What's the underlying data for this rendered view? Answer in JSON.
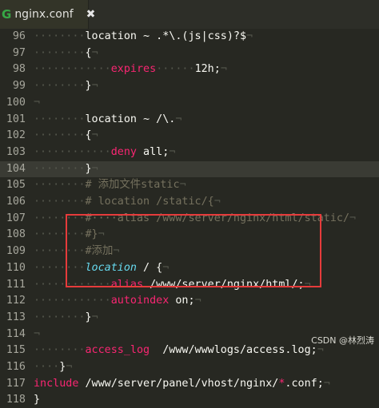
{
  "tab": {
    "title": "nginx.conf",
    "icon": "nginx-icon",
    "close": "✖",
    "badge": "G"
  },
  "lines": [
    {
      "num": "96",
      "segments": [
        {
          "t": "········",
          "c": "ws"
        },
        {
          "t": "location ~ .*\\.(js|css)?$",
          "c": "code"
        },
        {
          "t": "¬",
          "c": "ws"
        }
      ]
    },
    {
      "num": "97",
      "segments": [
        {
          "t": "········",
          "c": "ws"
        },
        {
          "t": "{",
          "c": "code"
        },
        {
          "t": "¬",
          "c": "ws"
        }
      ]
    },
    {
      "num": "98",
      "segments": [
        {
          "t": "········",
          "c": "ws"
        },
        {
          "t": "····",
          "c": "ws"
        },
        {
          "t": "expires",
          "c": "val"
        },
        {
          "t": "······",
          "c": "ws"
        },
        {
          "t": "12h;",
          "c": "code"
        },
        {
          "t": "¬",
          "c": "ws"
        }
      ]
    },
    {
      "num": "99",
      "segments": [
        {
          "t": "········",
          "c": "ws"
        },
        {
          "t": "}",
          "c": "code"
        },
        {
          "t": "¬",
          "c": "ws"
        }
      ]
    },
    {
      "num": "100",
      "segments": [
        {
          "t": "¬",
          "c": "ws"
        }
      ]
    },
    {
      "num": "101",
      "segments": [
        {
          "t": "········",
          "c": "ws"
        },
        {
          "t": "location ~ /\\.",
          "c": "code"
        },
        {
          "t": "¬",
          "c": "ws"
        }
      ]
    },
    {
      "num": "102",
      "segments": [
        {
          "t": "········",
          "c": "ws"
        },
        {
          "t": "{",
          "c": "code"
        },
        {
          "t": "¬",
          "c": "ws"
        }
      ]
    },
    {
      "num": "103",
      "segments": [
        {
          "t": "········",
          "c": "ws"
        },
        {
          "t": "····",
          "c": "ws"
        },
        {
          "t": "deny",
          "c": "val"
        },
        {
          "t": " all;",
          "c": "code"
        },
        {
          "t": "¬",
          "c": "ws"
        }
      ]
    },
    {
      "num": "104",
      "active": true,
      "segments": [
        {
          "t": "········",
          "c": "ws"
        },
        {
          "t": "}",
          "c": "code"
        },
        {
          "t": "¬",
          "c": "ws"
        }
      ]
    },
    {
      "num": "105",
      "segments": [
        {
          "t": "········",
          "c": "ws"
        },
        {
          "t": "# 添加文件static",
          "c": "cm"
        },
        {
          "t": "¬",
          "c": "ws"
        }
      ]
    },
    {
      "num": "106",
      "segments": [
        {
          "t": "········",
          "c": "ws"
        },
        {
          "t": "# location /static/{",
          "c": "cm"
        },
        {
          "t": "¬",
          "c": "ws"
        }
      ]
    },
    {
      "num": "107",
      "segments": [
        {
          "t": "········",
          "c": "ws"
        },
        {
          "t": "#····alias /www/server/nginx/html/static/",
          "c": "cm"
        },
        {
          "t": "¬",
          "c": "ws"
        }
      ]
    },
    {
      "num": "108",
      "segments": [
        {
          "t": "········",
          "c": "ws"
        },
        {
          "t": "#}",
          "c": "cm"
        },
        {
          "t": "¬",
          "c": "ws"
        }
      ]
    },
    {
      "num": "109",
      "segments": [
        {
          "t": "········",
          "c": "ws"
        },
        {
          "t": "#添加",
          "c": "cm"
        },
        {
          "t": "¬",
          "c": "ws"
        }
      ]
    },
    {
      "num": "110",
      "segments": [
        {
          "t": "········",
          "c": "ws"
        },
        {
          "t": "location",
          "c": "kw-cap"
        },
        {
          "t": " / {",
          "c": "code"
        },
        {
          "t": "¬",
          "c": "ws"
        }
      ]
    },
    {
      "num": "111",
      "segments": [
        {
          "t": "········",
          "c": "ws"
        },
        {
          "t": "····",
          "c": "ws"
        },
        {
          "t": "alias",
          "c": "val"
        },
        {
          "t": " /www/server/nginx/html/;",
          "c": "code"
        },
        {
          "t": "¬",
          "c": "ws"
        }
      ]
    },
    {
      "num": "112",
      "segments": [
        {
          "t": "········",
          "c": "ws"
        },
        {
          "t": "····",
          "c": "ws"
        },
        {
          "t": "autoindex",
          "c": "val"
        },
        {
          "t": " on;",
          "c": "code"
        },
        {
          "t": "¬",
          "c": "ws"
        }
      ]
    },
    {
      "num": "113",
      "segments": [
        {
          "t": "········",
          "c": "ws"
        },
        {
          "t": "}",
          "c": "code"
        },
        {
          "t": "¬",
          "c": "ws"
        }
      ]
    },
    {
      "num": "114",
      "segments": [
        {
          "t": "¬",
          "c": "ws"
        }
      ]
    },
    {
      "num": "115",
      "segments": [
        {
          "t": "········",
          "c": "ws"
        },
        {
          "t": "access_log",
          "c": "val"
        },
        {
          "t": "  /www/wwwlogs/access.log;",
          "c": "code"
        },
        {
          "t": "¬",
          "c": "ws"
        }
      ]
    },
    {
      "num": "116",
      "segments": [
        {
          "t": "····",
          "c": "ws"
        },
        {
          "t": "}",
          "c": "code"
        },
        {
          "t": "¬",
          "c": "ws"
        }
      ]
    },
    {
      "num": "117",
      "segments": [
        {
          "t": "include",
          "c": "val"
        },
        {
          "t": " /www/server/panel/vhost/nginx/",
          "c": "code"
        },
        {
          "t": "*",
          "c": "val"
        },
        {
          "t": ".conf;",
          "c": "code"
        },
        {
          "t": "¬",
          "c": "ws"
        }
      ]
    },
    {
      "num": "118",
      "segments": [
        {
          "t": "}",
          "c": "code"
        }
      ]
    }
  ],
  "watermark": "CSDN @林烈涛"
}
